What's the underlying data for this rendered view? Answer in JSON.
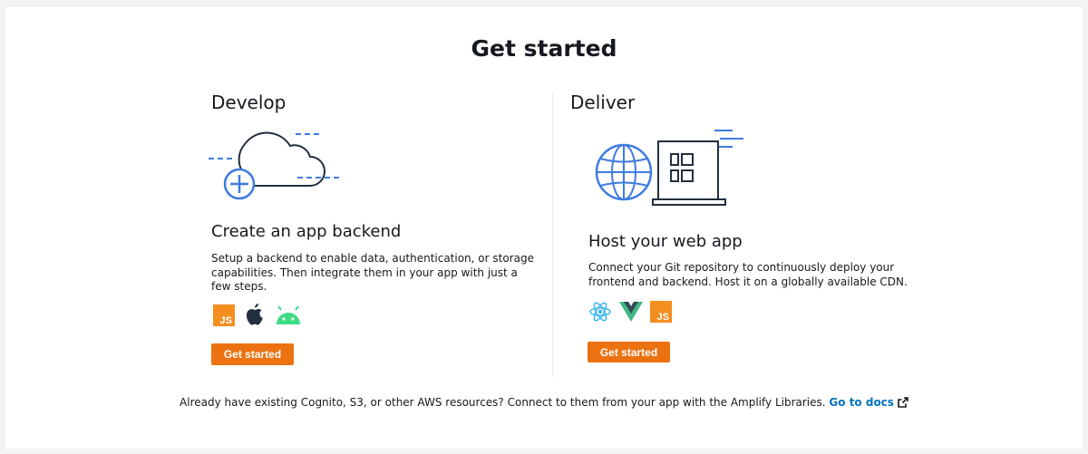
{
  "page": {
    "title": "Get started"
  },
  "develop": {
    "heading": "Develop",
    "subheading": "Create an app backend",
    "description_lines": [
      "Setup a backend to enable data, authentication, or storage",
      "capabilities. Then integrate them in your app with just a",
      "few steps."
    ],
    "platform_icons": [
      "javascript-icon",
      "apple-icon",
      "android-icon"
    ],
    "button_label": "Get started",
    "illustration": "cloud-add-illustration"
  },
  "deliver": {
    "heading": "Deliver",
    "subheading": "Host your web app",
    "description_lines": [
      "Connect your Git repository to continuously deploy your",
      "frontend and backend. Host it on a globally available CDN."
    ],
    "framework_icons": [
      "react-icon",
      "vue-icon",
      "javascript-icon"
    ],
    "button_label": "Get started",
    "illustration": "globe-laptop-illustration"
  },
  "footer": {
    "text": "Already have existing Cognito, S3, or other AWS resources? Connect to them from your app with the Amplify Libraries.",
    "link_label": "Go to docs",
    "link_icon": "external-link-icon"
  },
  "colors": {
    "accent": "#ec7211",
    "link": "#0073bb",
    "illustration_blue": "#3f7be0",
    "text": "#16191f"
  }
}
